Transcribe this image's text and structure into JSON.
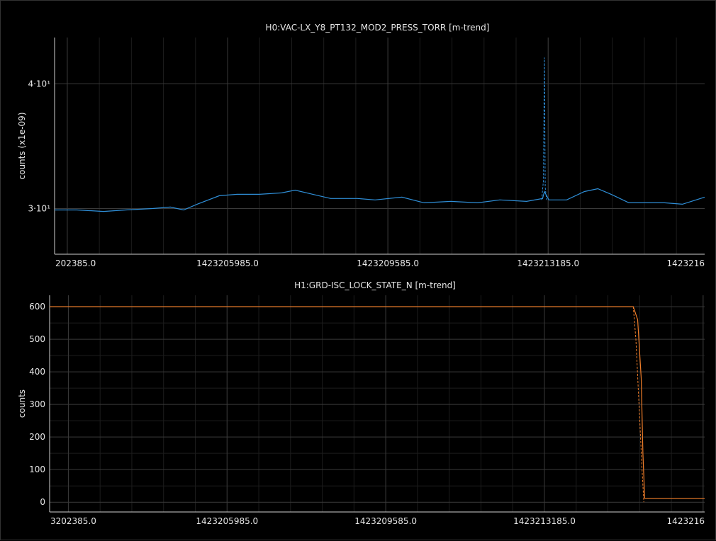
{
  "chart_data": [
    {
      "type": "line",
      "title": "H0:VAC-LX_Y8_PT132_MOD2_PRESS_TORR [m-trend]",
      "ylabel": "counts (x1e-09)",
      "xlabel": "",
      "yscale": "log",
      "ylim": [
        27,
        44.5
      ],
      "xlim": [
        1423202100,
        1423216700
      ],
      "x_ticks": [
        1423202385.0,
        1423205985.0,
        1423209585.0,
        1423213185.0,
        1423216785.0
      ],
      "x_tick_labels": [
        "202385.0",
        "1423205985.0",
        "1423209585.0",
        "1423213185.0",
        "1423216"
      ],
      "y_ticks": [
        30,
        40
      ],
      "y_tick_labels": [
        "3·10¹",
        "4·10¹"
      ],
      "grid": true,
      "color": "#2f8fd8",
      "series": [
        {
          "x": [
            1423202100,
            1423202600,
            1423203200,
            1423203700,
            1423204300,
            1423204700,
            1423205000,
            1423205300,
            1423205800,
            1423206200,
            1423206700,
            1423207200,
            1423207500,
            1423207900,
            1423208300,
            1423208900,
            1423209300,
            1423209900,
            1423210400,
            1423211000,
            1423211600,
            1423212100,
            1423212700,
            1423213060,
            1423213100,
            1423213200,
            1423213600,
            1423214000,
            1423214300,
            1423214600,
            1423215000,
            1423215400,
            1423215800,
            1423216200,
            1423216700
          ],
          "y": [
            29.9,
            29.9,
            29.8,
            29.9,
            30.0,
            30.1,
            29.9,
            30.3,
            30.9,
            31.0,
            31.0,
            31.1,
            31.3,
            31.0,
            30.7,
            30.7,
            30.6,
            30.8,
            30.4,
            30.5,
            30.4,
            30.6,
            30.5,
            30.7,
            31.2,
            30.6,
            30.6,
            31.2,
            31.4,
            31.0,
            30.4,
            30.4,
            30.4,
            30.3,
            30.8
          ]
        },
        {
          "style": "dashed",
          "x": [
            1423213040,
            1423213080,
            1423213100,
            1423213120,
            1423213150
          ],
          "y": [
            30.6,
            32.0,
            42.5,
            31.5,
            30.6
          ]
        }
      ]
    },
    {
      "type": "line",
      "title": "H1:GRD-ISC_LOCK_STATE_N [m-trend]",
      "ylabel": "counts",
      "xlabel": "",
      "ylim": [
        -30,
        635
      ],
      "xlim": [
        1423201960,
        1423216820
      ],
      "x_ticks": [
        1423202385.0,
        1423205985.0,
        1423209585.0,
        1423213185.0,
        1423216785.0
      ],
      "x_tick_labels": [
        "3202385.0",
        "1423205985.0",
        "1423209585.0",
        "1423213185.0",
        "1423216"
      ],
      "y_ticks": [
        0,
        100,
        200,
        300,
        400,
        500,
        600
      ],
      "y_tick_labels": [
        "0",
        "100",
        "200",
        "300",
        "400",
        "500",
        "600"
      ],
      "grid": true,
      "color": "#f07e2a",
      "series": [
        {
          "x": [
            1423201960,
            1423213800,
            1423215200,
            1423215300,
            1423215380,
            1423215420,
            1423215460,
            1423215520,
            1423215600,
            1423216000,
            1423216400,
            1423216820
          ],
          "y": [
            600,
            600,
            600,
            560,
            380,
            150,
            12,
            12,
            12,
            12,
            12,
            12
          ]
        },
        {
          "style": "dashed",
          "x": [
            1423215200,
            1423215260,
            1423215330,
            1423215400,
            1423215440
          ],
          "y": [
            600,
            500,
            300,
            100,
            0
          ]
        }
      ]
    }
  ]
}
